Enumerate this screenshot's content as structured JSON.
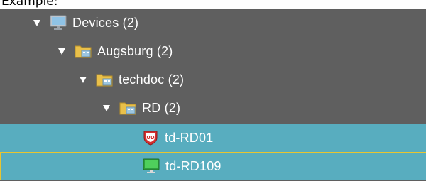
{
  "caption": "Example:",
  "tree": {
    "nodes": [
      {
        "label": "Devices (2)",
        "icon": "monitor-group-icon",
        "expanded": true
      },
      {
        "label": "Augsburg (2)",
        "icon": "folder-location-icon",
        "expanded": true
      },
      {
        "label": "techdoc (2)",
        "icon": "folder-location-icon",
        "expanded": true
      },
      {
        "label": "RD (2)",
        "icon": "folder-location-icon",
        "expanded": true
      },
      {
        "label": "td-RD01",
        "icon": "ud-shield-icon",
        "selected": true
      },
      {
        "label": "td-RD109",
        "icon": "green-monitor-icon",
        "selected": true,
        "focused": true
      }
    ]
  },
  "colors": {
    "tree_background": "#5f5f5f",
    "selection": "#58adbf",
    "focus_border": "#e8c531",
    "text": "#ffffff"
  }
}
